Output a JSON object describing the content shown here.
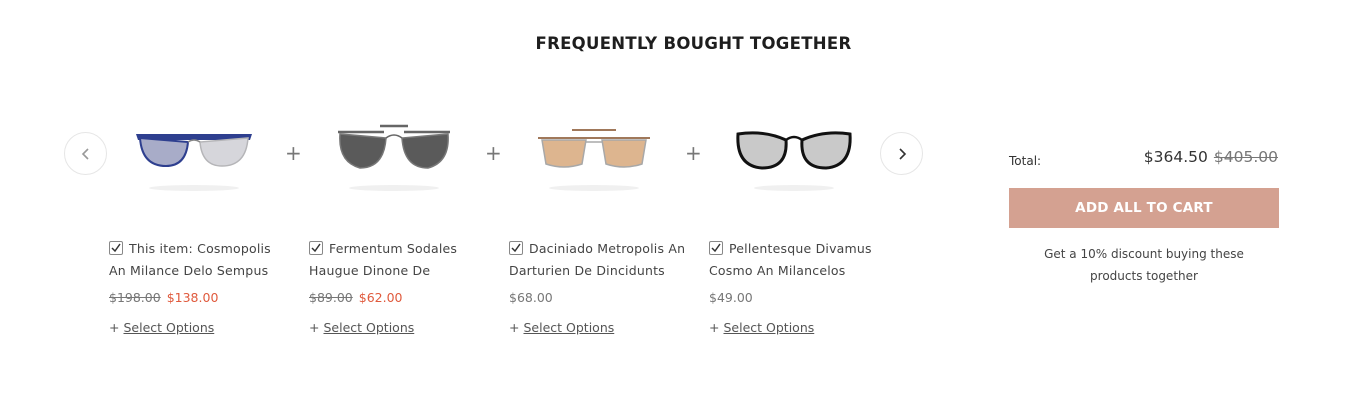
{
  "section": {
    "title": "FREQUENTLY BOUGHT TOGETHER"
  },
  "carousel": {
    "prev_icon": "chevron-left-icon",
    "next_icon": "chevron-right-icon",
    "separator": "+"
  },
  "products": [
    {
      "name": "This item: Cosmopolis An Milance Delo Sempus",
      "old_price": "$198.00",
      "price": "$138.00",
      "on_sale": true,
      "checked": true,
      "action_prefix": "+",
      "action": "Select Options",
      "image": "blue-silver-sunglasses"
    },
    {
      "name": "Fermentum Sodales Haugue Dinone De",
      "old_price": "$89.00",
      "price": "$62.00",
      "on_sale": true,
      "checked": true,
      "action_prefix": "+",
      "action": "Select Options",
      "image": "aviator-dark-sunglasses"
    },
    {
      "name": "Daciniado Metropolis An Darturien De Dincidunts",
      "old_price": "",
      "price": "$68.00",
      "on_sale": false,
      "checked": true,
      "action_prefix": "+",
      "action": "Select Options",
      "image": "gold-tan-aviator-sunglasses"
    },
    {
      "name": "Pellentesque Divamus Cosmo An Milancelos",
      "old_price": "",
      "price": "$49.00",
      "on_sale": false,
      "checked": true,
      "action_prefix": "+",
      "action": "Select Options",
      "image": "black-oversized-sunglasses"
    }
  ],
  "summary": {
    "total_label": "Total:",
    "total_price": "$364.50",
    "total_old_price": "$405.00",
    "button_label": "ADD ALL TO CART",
    "discount_line1": "Get a 10% discount buying these",
    "discount_line2": "products together"
  },
  "colors": {
    "accent_button": "#d4a191",
    "sale_price": "#e05a3d"
  }
}
